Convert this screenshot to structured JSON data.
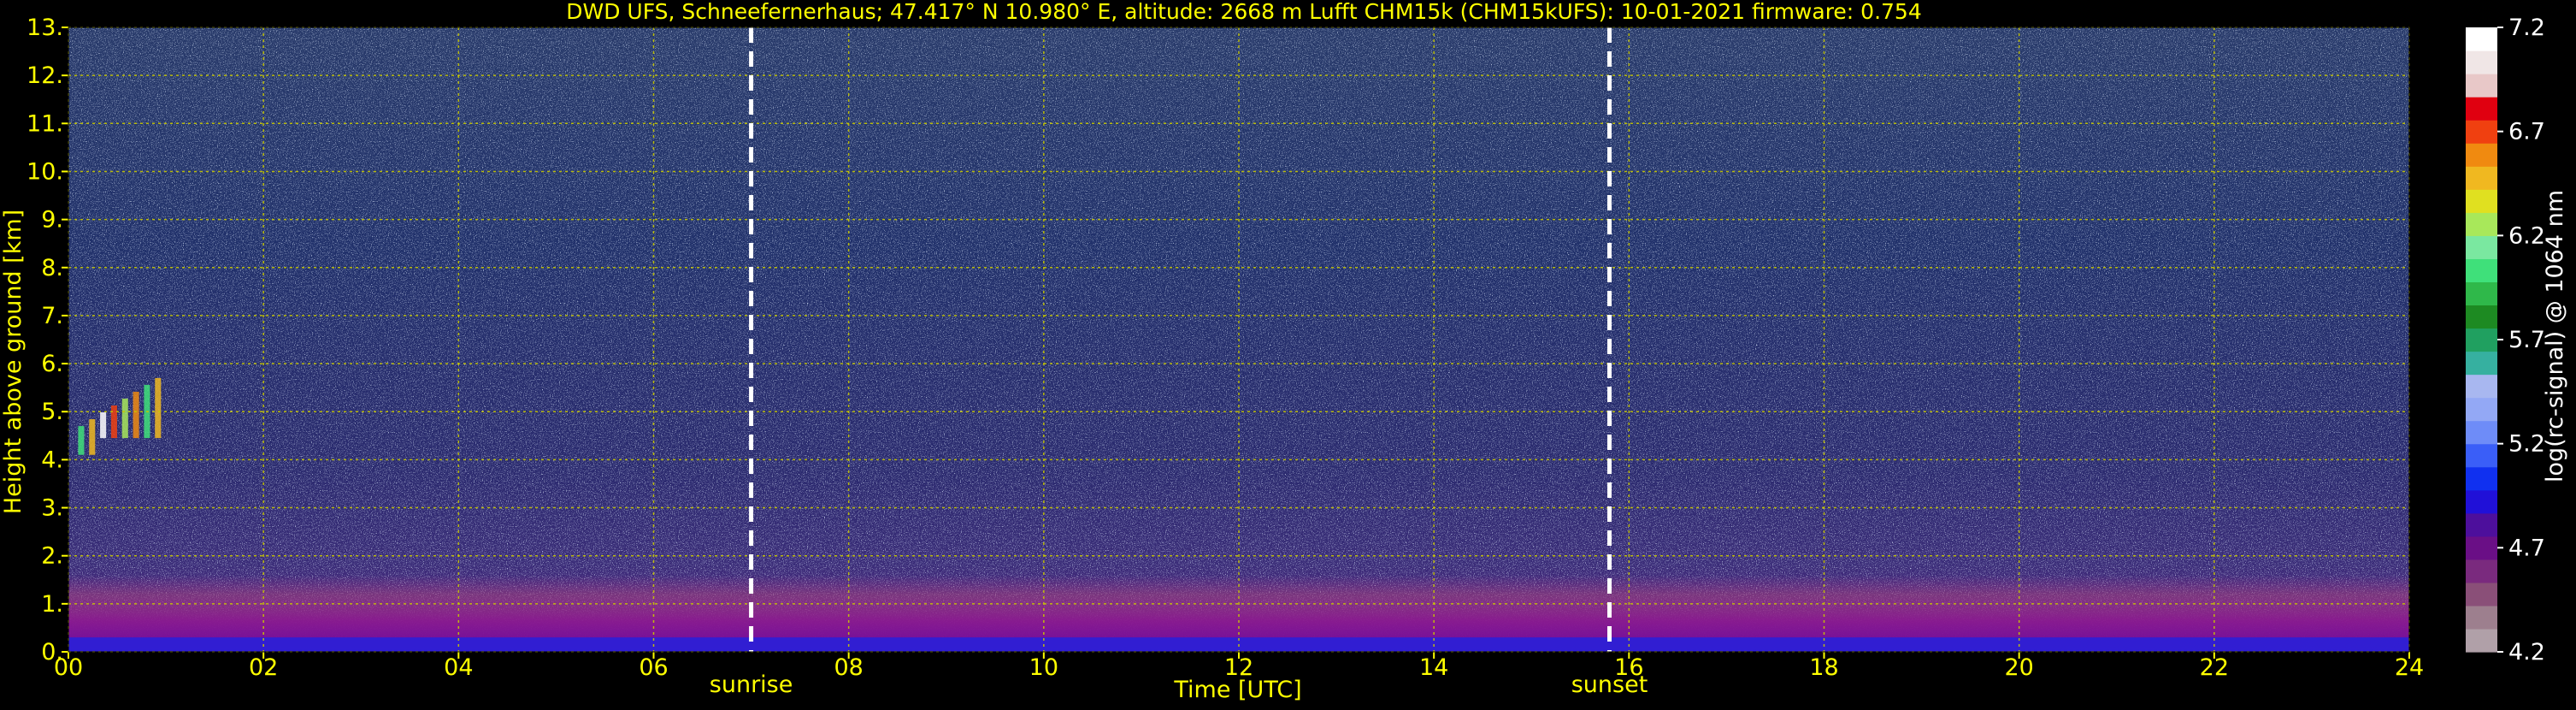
{
  "chart_data": {
    "type": "heatmap",
    "title": "DWD UFS, Schneefernerhaus; 47.417° N 10.980° E, altitude: 2668 m    Lufft CHM15k (CHM15kUFS): 10-01-2021    firmware: 0.754",
    "xlabel": "Time [UTC]",
    "ylabel": "Height above ground [km]",
    "xlim": [
      0,
      24
    ],
    "ylim": [
      0,
      13
    ],
    "xticks": [
      "00",
      "02",
      "04",
      "06",
      "08",
      "10",
      "12",
      "14",
      "16",
      "18",
      "20",
      "22",
      "24"
    ],
    "yticks": [
      "0.",
      "1.",
      "2.",
      "3.",
      "4.",
      "5.",
      "6.",
      "7.",
      "8.",
      "9.",
      "10.",
      "11.",
      "12.",
      "13."
    ],
    "grid": true,
    "markers": [
      {
        "label": "sunrise",
        "x": 7.0
      },
      {
        "label": "sunset",
        "x": 15.8
      }
    ],
    "colorbar": {
      "label": "log(rc-signal) @ 1064 nm",
      "range": [
        4.2,
        7.2
      ],
      "ticks": [
        "4.2",
        "4.7",
        "5.2",
        "5.7",
        "6.2",
        "6.7",
        "7.2"
      ],
      "colors": [
        "#b0a0a8",
        "#9d7f8e",
        "#8a4f78",
        "#7a2a7e",
        "#6a0f86",
        "#4d0f9c",
        "#2010d8",
        "#1030f0",
        "#3a5ef8",
        "#6e8cf8",
        "#93a8f5",
        "#a8b7f0",
        "#36b0a0",
        "#20a060",
        "#1d8a22",
        "#2fb84a",
        "#3fe07a",
        "#7ae8a0",
        "#a8e85a",
        "#e0e020",
        "#f0b820",
        "#f08a10",
        "#f04010",
        "#e00010",
        "#e8c8c8",
        "#f0e6e6",
        "#ffffff"
      ]
    },
    "features": [
      {
        "name": "boundary layer",
        "from": 0,
        "to": 24,
        "top_km": 1.6
      },
      {
        "name": "ground layer",
        "from": 0,
        "to": 24,
        "top_km": 0.3
      },
      {
        "name": "cloud",
        "from": 0.1,
        "to": 1.0,
        "bottom_km": 4.1,
        "top_km": 5.7
      }
    ],
    "colors": {
      "text": "#ffff00",
      "grid": "#c8c800",
      "marker": "#ffffff",
      "bg": "#000000"
    }
  }
}
